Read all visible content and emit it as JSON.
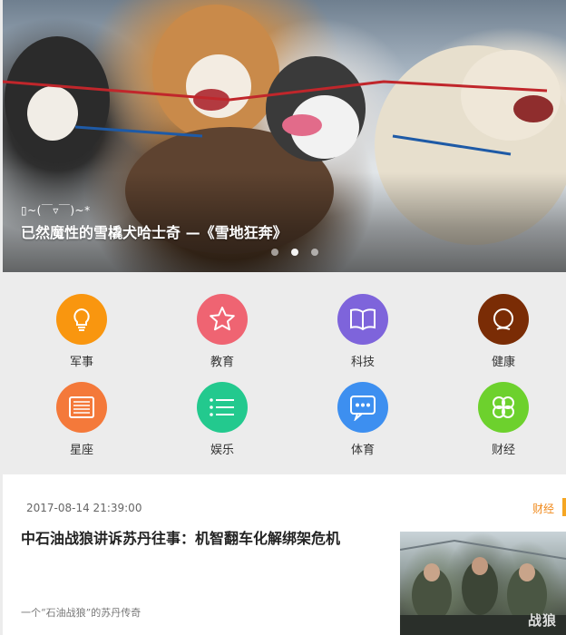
{
  "banner": {
    "subtitle": "▯~(￣▿￣)~*",
    "title": "已然魔性的雪橇犬哈士奇 —《雪地狂奔》",
    "dots_count": 3,
    "active_dot": 2
  },
  "categories": [
    {
      "label": "军事",
      "icon": "lightbulb-icon",
      "color": "#f9960f"
    },
    {
      "label": "教育",
      "icon": "star-icon",
      "color": "#ef6472"
    },
    {
      "label": "科技",
      "icon": "book-icon",
      "color": "#7e64db"
    },
    {
      "label": "健康",
      "icon": "q-icon",
      "color": "#7a2c05"
    },
    {
      "label": "星座",
      "icon": "newspaper-icon",
      "color": "#f4793a"
    },
    {
      "label": "娱乐",
      "icon": "list-icon",
      "color": "#23c98e"
    },
    {
      "label": "体育",
      "icon": "chat-icon",
      "color": "#3d8ff0"
    },
    {
      "label": "财经",
      "icon": "clover-icon",
      "color": "#6dd12d"
    }
  ],
  "news": {
    "time": "2017-08-14 21:39:00",
    "tag": "财经",
    "title": "中石油战狼讲诉苏丹往事：机智翻车化解绑架危机",
    "desc": "一个“石油战狼”的苏丹传奇",
    "thumb_logo": "战狼"
  }
}
